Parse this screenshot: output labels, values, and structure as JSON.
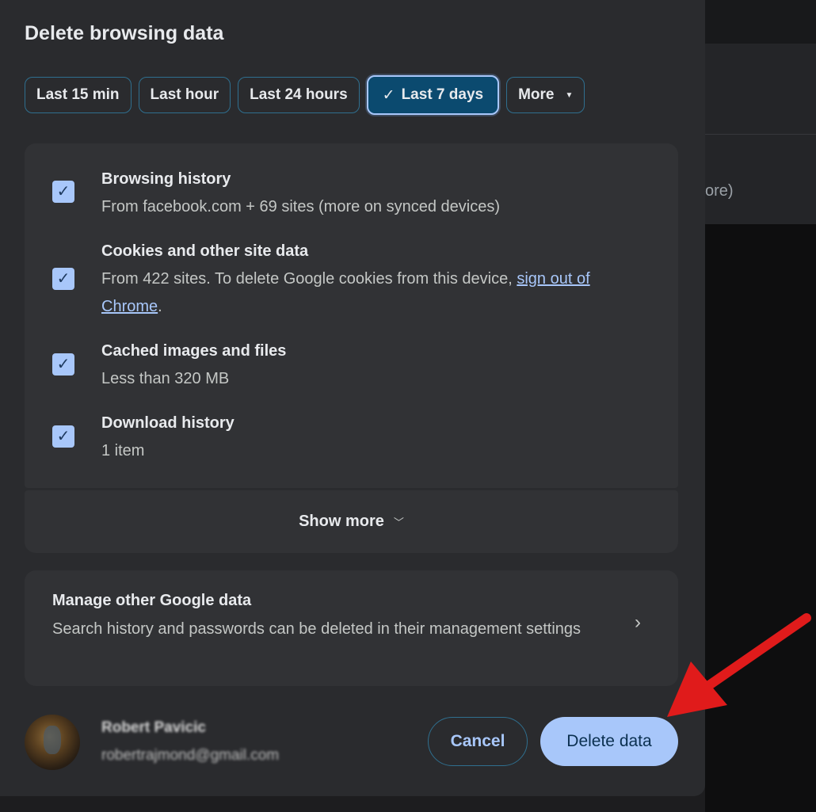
{
  "background": {
    "fragment_text": "ore)"
  },
  "dialog": {
    "title": "Delete browsing data",
    "time_ranges": [
      {
        "label": "Last 15 min",
        "selected": false
      },
      {
        "label": "Last hour",
        "selected": false
      },
      {
        "label": "Last 24 hours",
        "selected": false
      },
      {
        "label": "Last 7 days",
        "selected": true
      },
      {
        "label": "More",
        "selected": false
      }
    ],
    "items": [
      {
        "title": "Browsing history",
        "description": "From facebook.com + 69 sites (more on synced devices)",
        "checked": true
      },
      {
        "title": "Cookies and other site data",
        "description": "From 422 sites. To delete Google cookies from this device,",
        "link": "sign out of Chrome",
        "suffix": ".",
        "checked": true
      },
      {
        "title": "Cached images and files",
        "description": "Less than 320 MB",
        "checked": true
      },
      {
        "title": "Download history",
        "description": "1 item",
        "checked": true
      }
    ],
    "show_more_label": "Show more",
    "manage": {
      "title": "Manage other Google data",
      "description": "Search history and passwords can be deleted in their management settings"
    },
    "account": {
      "name": "Robert Pavicic",
      "email": "robertrajmond@gmail.com"
    },
    "cancel_label": "Cancel",
    "delete_label": "Delete data"
  },
  "colors": {
    "dialog_bg": "#2a2b2e",
    "card_bg": "#313235",
    "accent": "#a8c7fa",
    "selected_chip": "#0b4a6f",
    "annotation_arrow": "#e01b1b"
  },
  "icons": [
    "checkmark-icon",
    "caret-down-icon",
    "chevron-down-icon",
    "chevron-right-icon",
    "red-arrow-annotation"
  ]
}
